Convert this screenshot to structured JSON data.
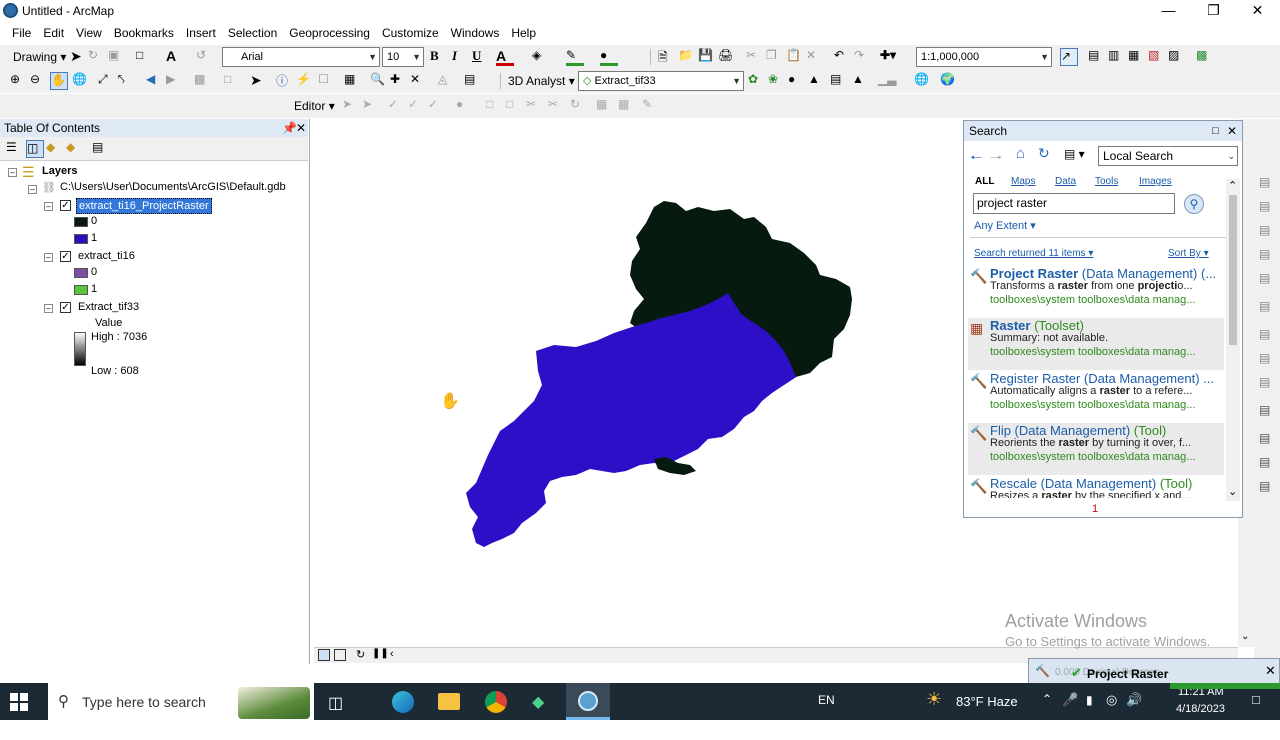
{
  "window": {
    "title": "Untitled - ArcMap"
  },
  "menu": [
    "File",
    "Edit",
    "View",
    "Bookmarks",
    "Insert",
    "Selection",
    "Geoprocessing",
    "Customize",
    "Windows",
    "Help"
  ],
  "toolbar1": {
    "drawing_label": "Drawing",
    "font": "Arial",
    "font_size": "10",
    "bold": "B",
    "italic": "I",
    "underline": "U",
    "scale": "1:1,000,000"
  },
  "toolbar2": {
    "analyst_label": "3D Analyst",
    "layer_select": "Extract_tif33"
  },
  "toolbar3": {
    "editor_label": "Editor"
  },
  "toc": {
    "title": "Table Of Contents",
    "root_label": "Layers",
    "gdb_path": "C:\\Users\\User\\Documents\\ArcGIS\\Default.gdb",
    "layers": [
      {
        "name": "extract_ti16_ProjectRaster",
        "selected": true,
        "classes": [
          {
            "label": "0",
            "color": "#0a1a12"
          },
          {
            "label": "1",
            "color": "#2a10b8"
          }
        ]
      },
      {
        "name": "extract_ti16",
        "selected": false,
        "classes": [
          {
            "label": "0",
            "color": "#7b4fa0"
          },
          {
            "label": "1",
            "color": "#5bc43a"
          }
        ]
      }
    ],
    "raster_layer": {
      "name": "Extract_tif33",
      "value_label": "Value",
      "high": "High : 7036",
      "low": "Low : 608"
    }
  },
  "map": {
    "colors": {
      "class0": "#061a10",
      "class1": "#2d0fc8"
    }
  },
  "search": {
    "title": "Search",
    "scope": "Local Search",
    "tabs": [
      "ALL",
      "Maps",
      "Data",
      "Tools",
      "Images"
    ],
    "query": "project raster",
    "extent": "Any Extent",
    "results_count": "Search returned 11 items",
    "sort": "Sort By",
    "page": "1",
    "results": [
      {
        "title": "Project Raster",
        "type": " (Data Management) (...",
        "desc_parts": [
          "Transforms a ",
          "raster",
          " from one ",
          "projecti",
          "o..."
        ],
        "path": "toolboxes\\system toolboxes\\data manag...",
        "icon": "hammer"
      },
      {
        "title": "Raster",
        "type": " (Toolset)",
        "desc_parts": [
          "Summary: not available."
        ],
        "path": "toolboxes\\system toolboxes\\data manag...",
        "icon": "toolbox"
      },
      {
        "title": "Register Raster",
        "type": " (Data Management) ...",
        "desc_parts": [
          "Automatically aligns a ",
          "raster",
          " to a refere..."
        ],
        "path": "toolboxes\\system toolboxes\\data manag...",
        "icon": "hammer"
      },
      {
        "title": "Flip (Data Management)",
        "type": " (Tool)",
        "desc_parts": [
          "Reorients the ",
          "raster",
          " by turning it over, f..."
        ],
        "path": "toolboxes\\system toolboxes\\data manag...",
        "icon": "hammer"
      },
      {
        "title": "Rescale (Data Management)",
        "type": " (Tool)",
        "desc_parts": [
          "Resizes a ",
          "raster",
          " by the specified x and..."
        ],
        "path": "",
        "icon": "hammer"
      }
    ]
  },
  "watermark": {
    "line1": "Activate Windows",
    "line2": "Go to Settings to activate Windows."
  },
  "popup": {
    "label": "Project Raster",
    "sub": "0.000 Decimal Degrees"
  },
  "taskbar": {
    "search_placeholder": "Type here to search",
    "lang": "EN",
    "weather": "83°F  Haze",
    "time": "11:21 AM",
    "date": "4/18/2023"
  }
}
